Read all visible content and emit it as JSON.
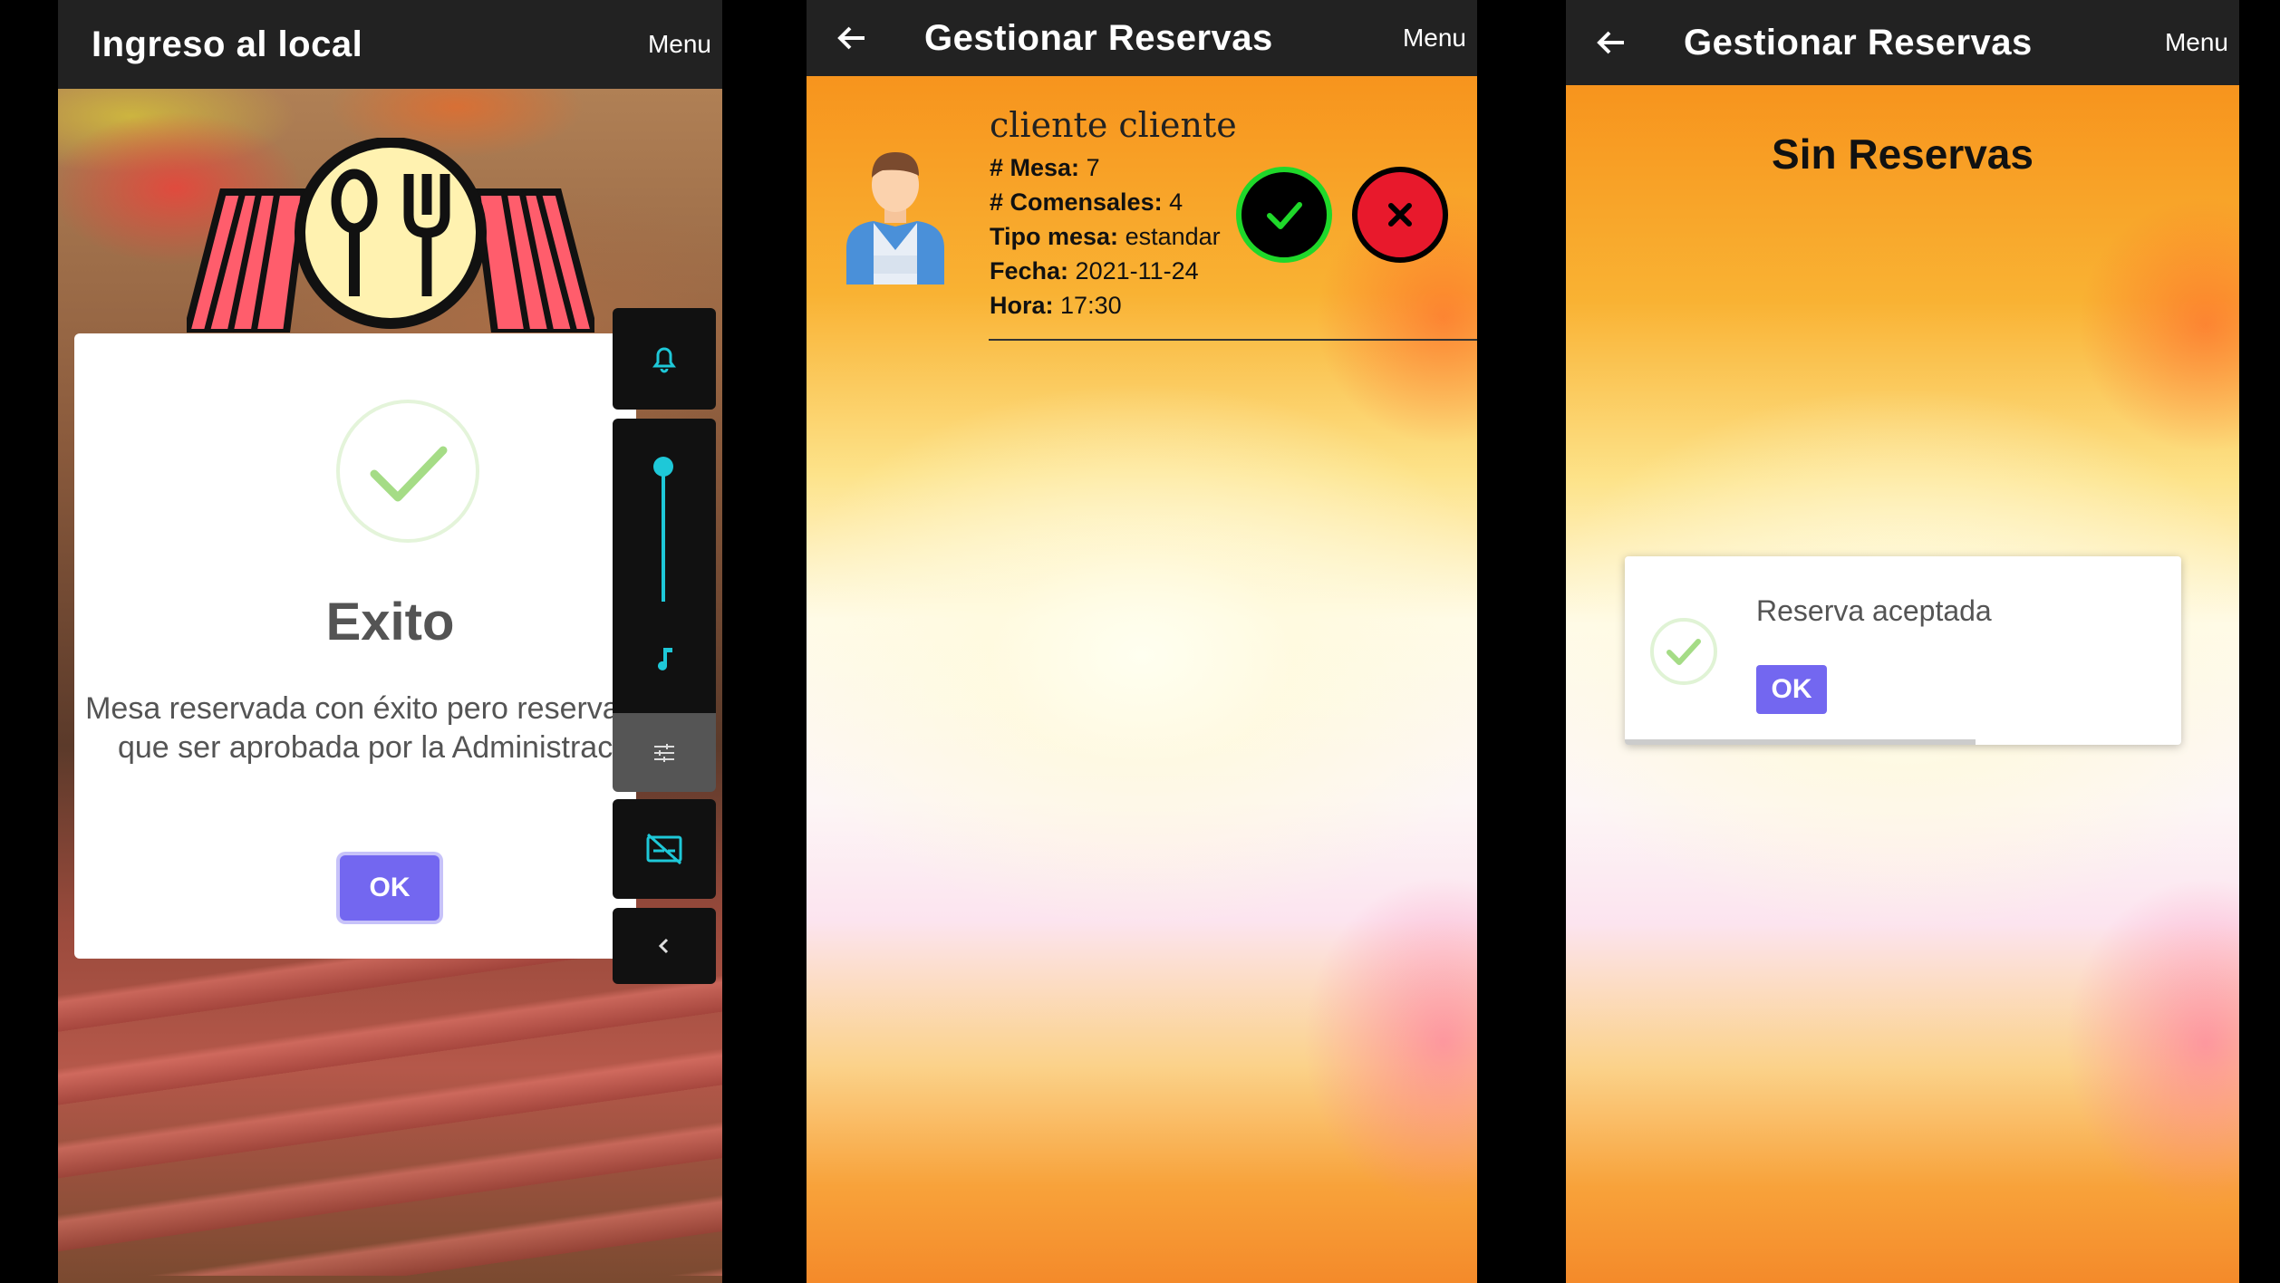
{
  "screen1": {
    "appbar": {
      "title": "Ingreso al local",
      "menu": "Menu"
    },
    "dialog": {
      "title": "Exito",
      "message": "Mesa reservada con éxito pero reserva tiene que ser aprobada por la Administración.",
      "ok_label": "OK"
    },
    "accent": "#7367f0"
  },
  "screen2": {
    "appbar": {
      "title": "Gestionar Reservas",
      "menu": "Menu"
    },
    "reservation": {
      "client": "cliente cliente",
      "mesa_label": "# Mesa:",
      "mesa": "7",
      "comensales_label": "# Comensales:",
      "comensales": "4",
      "tipo_label": "Tipo mesa:",
      "tipo": "estandar",
      "fecha_label": "Fecha:",
      "fecha": "2021-11-24",
      "hora_label": "Hora:",
      "hora": "17:30"
    },
    "colors": {
      "accept": "#1fd82a",
      "reject": "#e8192c"
    }
  },
  "screen3": {
    "appbar": {
      "title": "Gestionar Reservas",
      "menu": "Menu"
    },
    "empty_text": "Sin Reservas",
    "toast": {
      "message": "Reserva aceptada",
      "ok_label": "OK",
      "progress": 0.63
    }
  }
}
